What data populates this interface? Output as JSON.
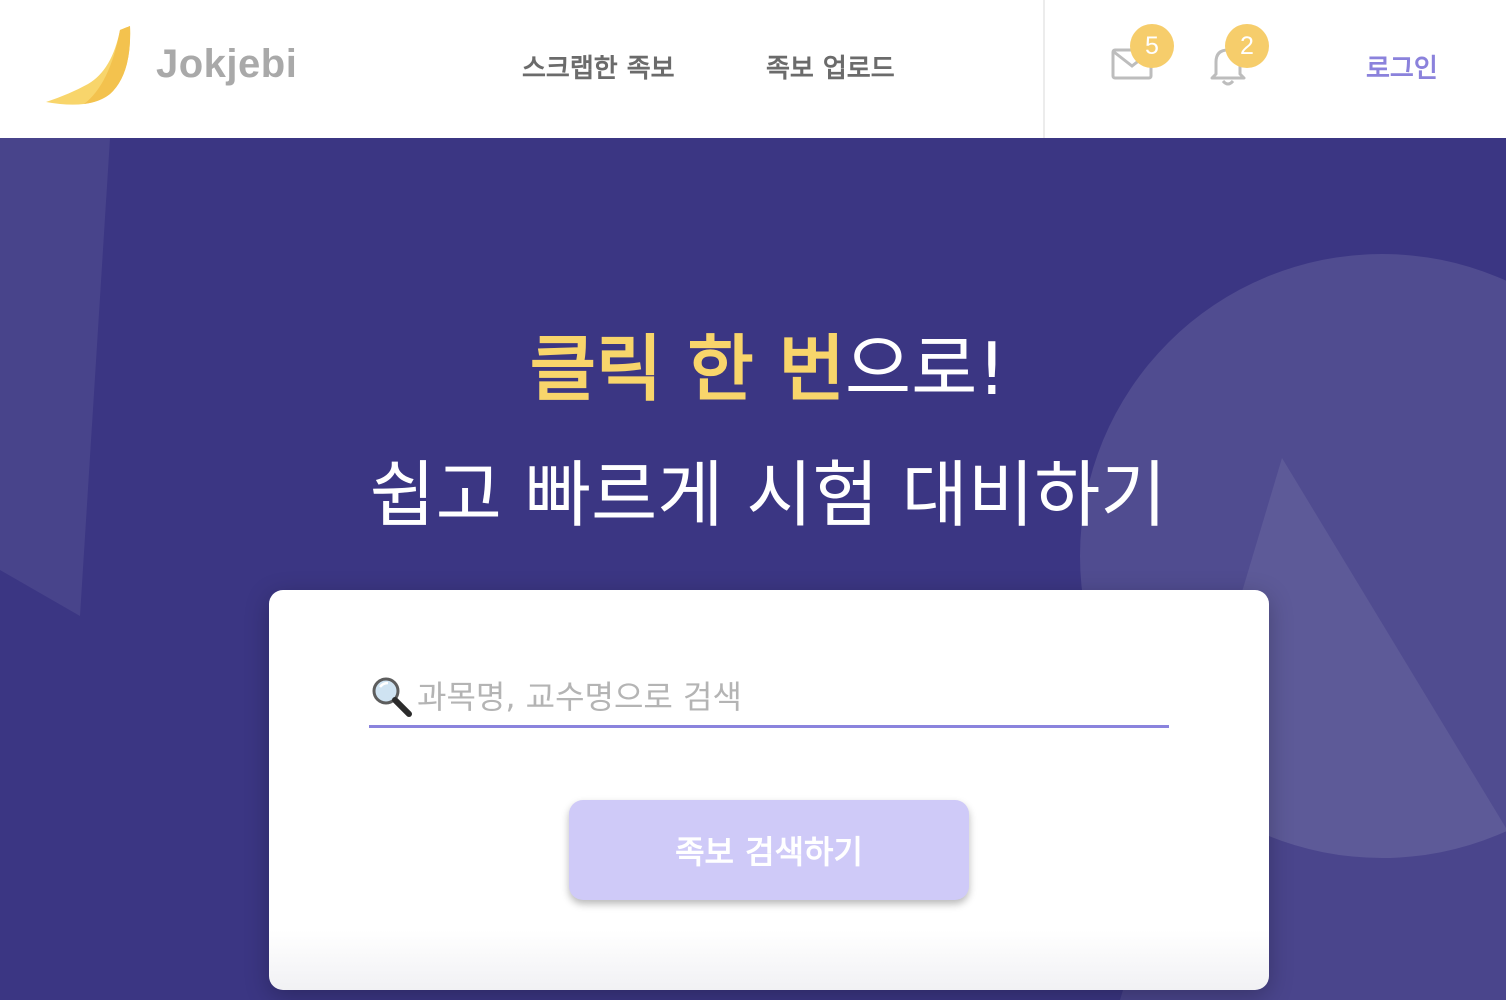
{
  "header": {
    "brand": "Jokjebi",
    "nav": {
      "scrap_label": "스크랩한 족보",
      "upload_label": "족보 업로드"
    },
    "mail_badge": "5",
    "bell_badge": "2",
    "login_label": "로그인"
  },
  "hero": {
    "headline_highlight": "클릭 한 번",
    "headline_rest": "으로!",
    "subheadline": "쉽고 빠르게 시험 대비하기"
  },
  "search": {
    "placeholder": "과목명, 교수명으로 검색",
    "button_label": "족보 검색하기"
  },
  "colors": {
    "accent_purple": "#8b82dc",
    "hero_background": "#3b3683",
    "highlight_yellow": "#f8d56b",
    "badge_yellow": "#f6cd6b",
    "button_lavender": "#cfcaf8"
  },
  "icons": {
    "logo": "jokjebi-logo",
    "mail": "mail-icon",
    "bell": "bell-icon",
    "search": "magnifier-icon"
  }
}
